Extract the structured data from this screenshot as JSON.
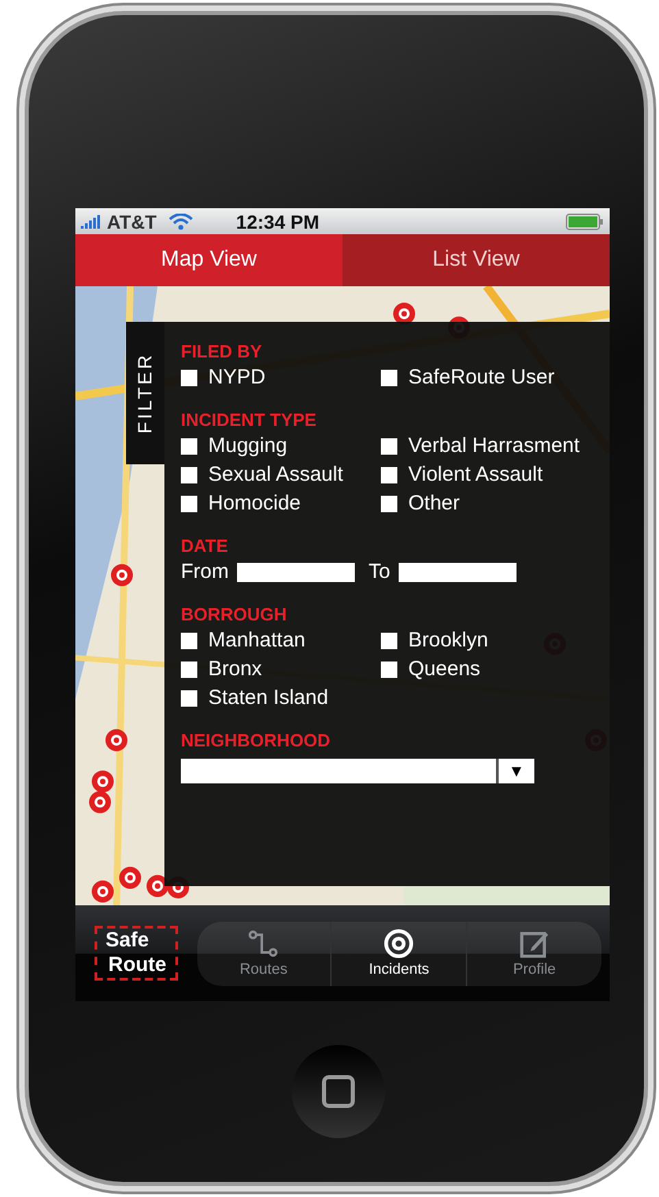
{
  "status_bar": {
    "carrier": "AT&T",
    "time": "12:34 PM"
  },
  "view_tabs": [
    {
      "label": "Map View",
      "selected": true
    },
    {
      "label": "List View",
      "selected": false
    }
  ],
  "filter": {
    "tab_label": "FILTER",
    "sections": [
      {
        "kind": "checkboxes",
        "title": "FILED BY",
        "options": [
          {
            "label": "NYPD",
            "checked": false
          },
          {
            "label": "SafeRoute User",
            "checked": false
          }
        ]
      },
      {
        "kind": "checkboxes",
        "title": "INCIDENT TYPE",
        "options": [
          {
            "label": "Mugging",
            "checked": false
          },
          {
            "label": "Verbal Harrasment",
            "checked": false
          },
          {
            "label": "Sexual Assault",
            "checked": false
          },
          {
            "label": "Violent Assault",
            "checked": false
          },
          {
            "label": "Homocide",
            "checked": false
          },
          {
            "label": "Other",
            "checked": false
          }
        ]
      },
      {
        "kind": "dates",
        "title": "DATE",
        "from_label": "From",
        "to_label": "To"
      },
      {
        "kind": "checkboxes",
        "title": "BORROUGH",
        "options": [
          {
            "label": "Manhattan",
            "checked": false
          },
          {
            "label": "Brooklyn",
            "checked": false
          },
          {
            "label": "Bronx",
            "checked": false
          },
          {
            "label": "Queens",
            "checked": false
          },
          {
            "label": "Staten Island",
            "checked": false
          }
        ]
      },
      {
        "kind": "dropdown",
        "title": "NEIGHBORHOOD",
        "arrow": "▼"
      }
    ]
  },
  "logo": {
    "line_1": "Safe",
    "line_2": "Route"
  },
  "nav_tabs": [
    {
      "label": "Routes",
      "selected": false
    },
    {
      "label": "Incidents",
      "selected": true
    },
    {
      "label": "Profile",
      "selected": false
    }
  ]
}
